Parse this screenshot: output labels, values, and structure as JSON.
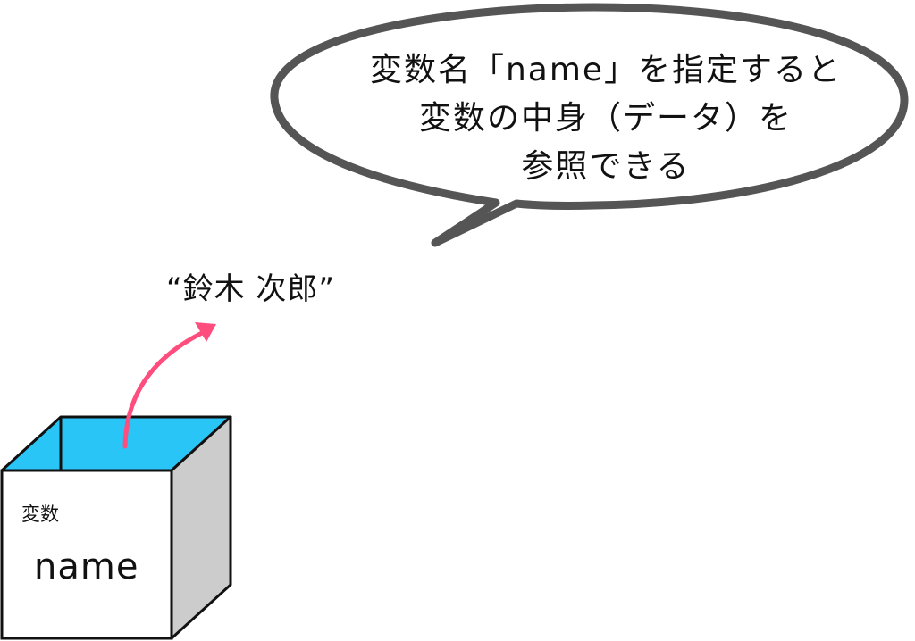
{
  "bubble": {
    "lines": [
      "変数名「name」を指定すると",
      "変数の中身（データ）を",
      "参照できる"
    ]
  },
  "value": "“鈴木 次郎”",
  "box": {
    "caption": "変数",
    "name": "name"
  },
  "colors": {
    "box_top": "#29c5f6",
    "box_side": "#cccccc",
    "box_front": "#ffffff",
    "outline": "#111111",
    "bubble_border": "#555555",
    "arrow": "#ff4d7e"
  }
}
